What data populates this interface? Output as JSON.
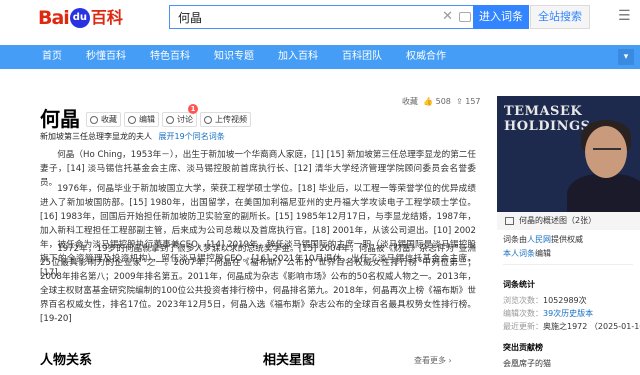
{
  "header": {
    "logo_bai": "Bai",
    "logo_du": "du",
    "logo_baike": "百科",
    "search_value": "何晶",
    "enter_button": "进入词条",
    "web_search_button": "全站搜索"
  },
  "nav": {
    "items": [
      "首页",
      "秒懂百科",
      "特色百科",
      "知识专题",
      "加入百科",
      "百科团队",
      "权威合作"
    ]
  },
  "entry": {
    "title": "何晶",
    "tools": {
      "collect": "收藏",
      "edit": "编辑",
      "discuss": "讨论",
      "discuss_count": "1",
      "video": "上传视频"
    },
    "stats": {
      "likes": "508",
      "shares": "157"
    },
    "subtitle": "新加坡第三任总理李显龙的夫人",
    "synonyms_link": "展开19个同名词条",
    "paragraphs": [
      "何晶（Ho Ching，1953年－），出生于新加坡一个华裔商人家庭，[1] [15] 新加坡第三任总理李显龙的第二任妻子，[14] 淡马锡信托基金会主席、淡马锡控股前首席执行长、[12] 清华大学经济管理学院顾问委员会名誉委员。",
      "1976年，何晶毕业于新加坡国立大学，荣获工程学硕士学位。[18] 毕业后，以工程一等荣誉学位的优异成绩进入了新加坡国防部。[15] 1980年，出国留学，在美国加利福尼亚州的史丹福大学攻读电子工程学硕士学位。[16] 1983年，回国后开始担任新加坡防卫实验室的副所长。[15] 1985年12月17日，与李显龙结婚，1987年，加入新科工程担任工程部副主管，后来成为公司总裁以及首席执行官。[18] 2001年，从该公司退出。[10] 2002年，被任命为淡马锡控股执行董事兼CEO。[14] 2019年，辞任淡马锡国际的主席一职（淡马锡国际是淡马锡控股旗下的全资管理及投资机构），留任淡马锡控股CEO。[16] 2021年10月退休，出任了淡马锡信托基金会主席。[17]",
      "1972年，19岁的何晶就拿到了很多人梦寐以求的总统奖学金。[15] 2004年，何晶被《财富》杂志评为“亚洲25位最具影响力的企业家”之一。2007年，何晶在《福布斯》公布的“世界百名权威女性排行榜”中列位第三；2008年排名第八；2009年排名第五。2011年，何晶成为杂志《影响市场》公布的50名权威人物之一。2013年，全球主权财富基金研究院编制的100位公共投资者排行榜中，何晶排名第九。2018年，何晶再次上榜《福布斯》世界百名权威女性，排名17位。2023年12月5日，何晶入选《福布斯》杂志公布的全球百名最具权势女性排行榜。[19-20]"
    ],
    "sections": {
      "relations": "人物关系",
      "gallery": "相关星图",
      "see_more": "查看更多"
    }
  },
  "sidebar": {
    "photo_text": [
      "TEMASEK",
      "HOLDINGS"
    ],
    "album_label": "何晶的概述图（2张）",
    "actions": {
      "collect_prefix": "词条由",
      "collect_link": "人民网",
      "collect_suffix": "提供权威",
      "edit_note_a": "本人词条",
      "edit_note_b": "编辑"
    },
    "stats_title": "词条统计",
    "views_label": "浏览次数：",
    "views_value": "1052989次",
    "edits_label": "编辑次数：",
    "edits_value": "39次历史版本",
    "updated_label": "最近更新：",
    "updated_value": "奥施之1972 （2025-01-16）",
    "contrib_title": "突出贡献榜",
    "contrib_name": "会凰席子的猫"
  }
}
